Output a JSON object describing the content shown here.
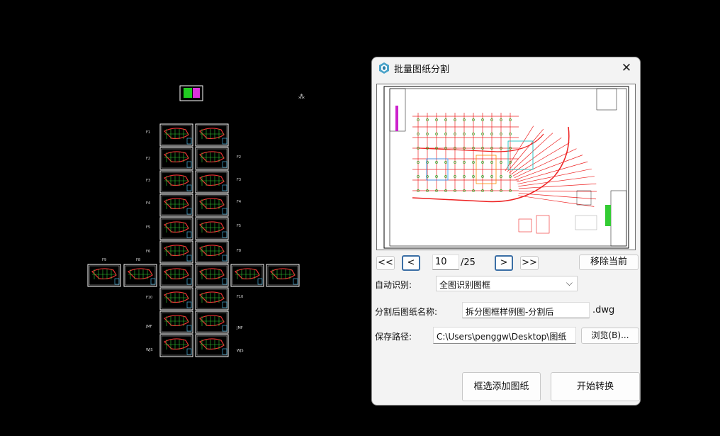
{
  "dialog": {
    "title": "批量图纸分割",
    "close_glyph": "✕",
    "nav": {
      "first": "<<",
      "prev": "<",
      "page": "10",
      "total": "/25",
      "next": ">",
      "last": ">>"
    },
    "remove_current": "移除当前",
    "auto_detect": {
      "label": "自动识别:",
      "value": "全图识别图框",
      "chevron": "⌵"
    },
    "output_name": {
      "label": "分割后图纸名称:",
      "value": "拆分图框样例图-分割后",
      "ext": ".dwg"
    },
    "save_path": {
      "label": "保存路径:",
      "value": "C:\\Users\\penggw\\Desktop\\图纸",
      "browse": "浏览(B)..."
    },
    "select_add": "框选添加图纸",
    "start": "开始转换"
  },
  "cad": {
    "floor_labels_left": [
      "F1",
      "F2",
      "F3",
      "F4",
      "F5",
      "F6",
      "F10",
      "JMF",
      "WJS"
    ],
    "floor_labels_right": [
      "F2",
      "F3",
      "F4",
      "F5",
      "F8",
      "F10",
      "JMF",
      "WJS"
    ],
    "row_labels": [
      "F9",
      "F8"
    ]
  },
  "colors": {
    "cad_bg": "#000000",
    "dialog_bg": "#f3f3f3",
    "accent": "#3a6ea5"
  }
}
